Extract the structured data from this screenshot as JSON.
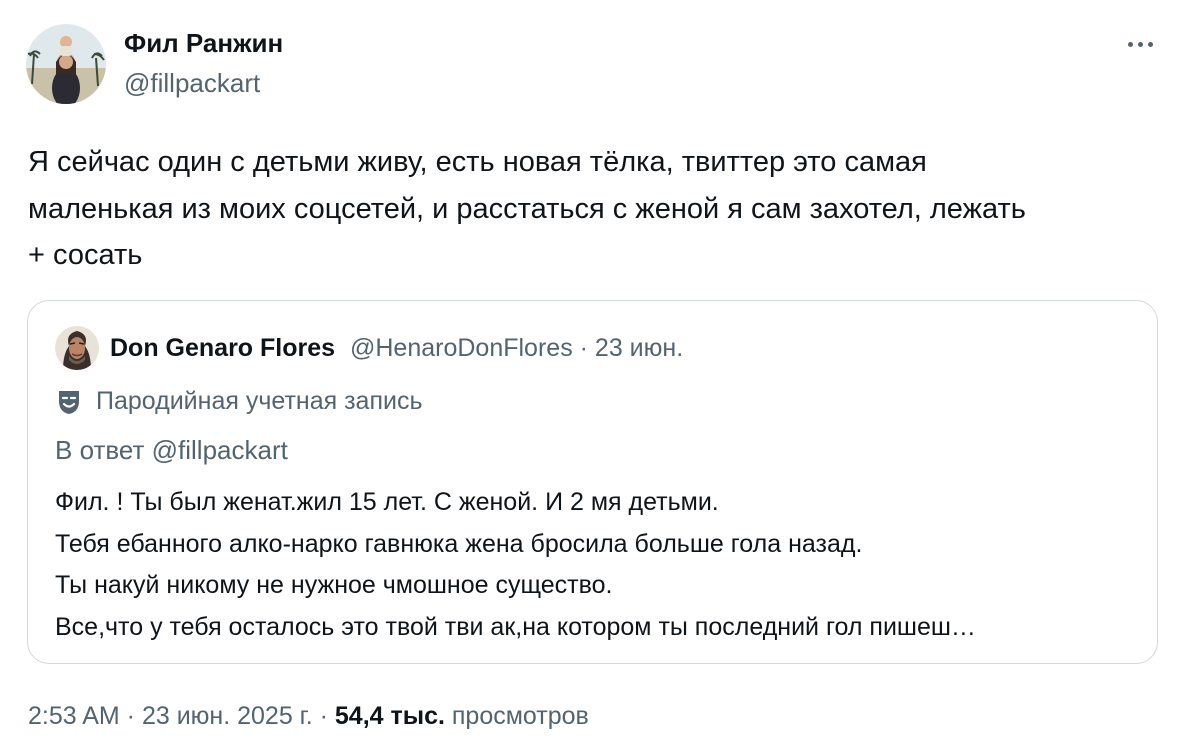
{
  "author": {
    "name": "Фил Ранжин",
    "handle": "@fillpackart"
  },
  "tweet": {
    "lines": [
      "Я сейчас один с детьми живу, есть новая тёлка, твиттер это самая",
      "маленькая из моих соцсетей, и расстаться с женой я сам захотел, лежать",
      "+ сосать"
    ]
  },
  "quote": {
    "name": "Don Genaro Flores",
    "handle": "@HenaroDonFlores",
    "separator": " · ",
    "date": "23 июн.",
    "parody_label": "Пародийная учетная запись",
    "reply_prefix": "В ответ ",
    "reply_mention": "@fillpackart",
    "body_lines": [
      "Фил. ! Ты был женат.жил 15 лет. С женой. И 2 мя детьми.",
      "Тебя ебанного алко-нарко гавнюка жена бросила больше гола назад.",
      "Ты накуй никому не нужное чмошное существо.",
      "Все,что у тебя осталось это твой тви ак,на котором ты последний гол пишеш…"
    ]
  },
  "footer": {
    "time_date": "2:53 AM · 23 июн. 2025 г. · ",
    "views_count": "54,4 тыс.",
    "views_label": " просмотров"
  },
  "icons": {
    "more": "more-horizontal-icon",
    "parody": "theater-mask-icon"
  },
  "colors": {
    "text_primary": "#0f1419",
    "text_secondary": "#536471",
    "border": "#cfd9de"
  }
}
